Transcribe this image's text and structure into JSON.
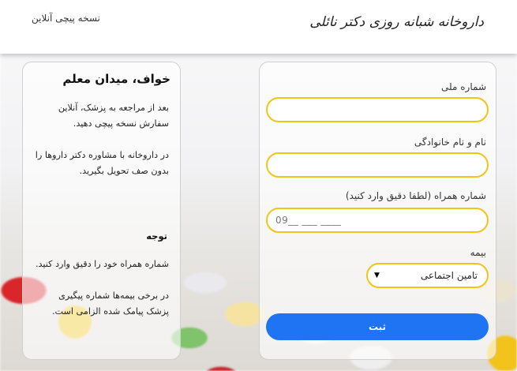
{
  "header": {
    "logo_text": "داروخانه شبانه روزی دکتر نائلی",
    "online_link": "نسخه پیچی آنلاین"
  },
  "form": {
    "national_id_label": "شماره ملی",
    "national_id_value": "",
    "fullname_label": "نام و نام خانوادگی",
    "fullname_value": "",
    "phone_label": "شماره همراه (لطفا دقیق وارد کنید)",
    "phone_placeholder": "09__ ___ ____",
    "insurance_label": "بیمه",
    "insurance_selected": "تامین اجتماعی",
    "submit_label": "ثبت"
  },
  "info": {
    "title": "خواف، میدان معلم",
    "paragraph1": "بعد از مراجعه به پزشک، آنلاین سفارش نسخه پیچی دهید.",
    "paragraph2": "در داروخانه با مشاوره دکتر داروها را بدون صف تحویل بگیرید.",
    "notice_title": "توجه",
    "notice1": "شماره همراه خود را دقیق وارد کنید.",
    "notice2": "در برخی بیمه‌ها شماره پیگیری پزشک پیامک شده الزامی است."
  },
  "colors": {
    "accent_border": "#f0c419",
    "submit_bg": "#1e74f2"
  }
}
